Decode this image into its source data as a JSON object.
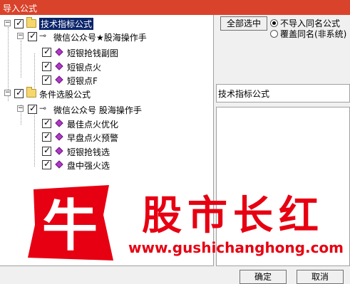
{
  "window": {
    "title": "导入公式"
  },
  "tree": [
    {
      "label": "技术指标公式",
      "kind": "folder",
      "level": 0
    },
    {
      "label": "微信公众号★股海操作手",
      "kind": "group",
      "level": 1
    },
    {
      "label": "短银抢钱副图",
      "kind": "item",
      "level": 2
    },
    {
      "label": "短银点火",
      "kind": "item",
      "level": 2
    },
    {
      "label": "短银点F",
      "kind": "item",
      "level": 2
    },
    {
      "label": "条件选股公式",
      "kind": "folder",
      "level": 0
    },
    {
      "label": "微信公众号 股海操作手",
      "kind": "group",
      "level": 1
    },
    {
      "label": "最佳点火优化",
      "kind": "item",
      "level": 2
    },
    {
      "label": "早盘点火预警",
      "kind": "item",
      "level": 2
    },
    {
      "label": "短银抢钱选",
      "kind": "item",
      "level": 2
    },
    {
      "label": "盘中强火选",
      "kind": "item",
      "level": 2
    }
  ],
  "right": {
    "select_all_label": "全部选中",
    "option_skip": "不导入同名公式",
    "option_overwrite": "覆盖同名(非系统)",
    "selected_option": "skip",
    "info_label": "技术指标公式"
  },
  "watermark": {
    "logo_char": "牛",
    "brand": "股市长红",
    "url": "www.gushichanghong.com"
  },
  "footer": {
    "ok_label": "确定",
    "cancel_label": "取消"
  },
  "colors": {
    "titlebar": "#d9432b",
    "selection": "#0a246a",
    "watermark": "#e60012",
    "item_diamond": "#b038c8"
  }
}
